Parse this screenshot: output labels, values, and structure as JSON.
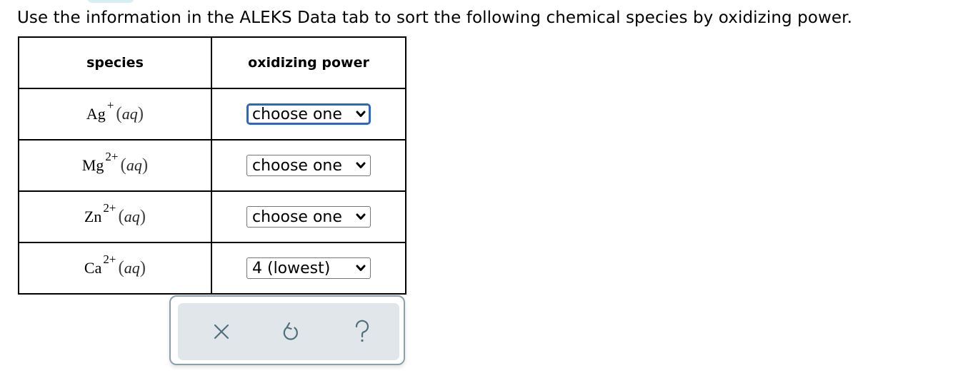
{
  "instruction": "Use the information in the ALEKS Data tab to sort the following chemical species by oxidizing power.",
  "table": {
    "headers": {
      "species": "species",
      "power": "oxidizing power"
    },
    "rows": [
      {
        "symbol": "Ag",
        "charge": "+",
        "state_open": "(",
        "state": "aq",
        "state_close": ")",
        "selected": "choose one",
        "focused": true
      },
      {
        "symbol": "Mg",
        "charge": "2+",
        "state_open": "(",
        "state": "aq",
        "state_close": ")",
        "selected": "choose one",
        "focused": false
      },
      {
        "symbol": "Zn",
        "charge": "2+",
        "state_open": "(",
        "state": "aq",
        "state_close": ")",
        "selected": "choose one",
        "focused": false
      },
      {
        "symbol": "Ca",
        "charge": "2+",
        "state_open": "(",
        "state": "aq",
        "state_close": ")",
        "selected": "4 (lowest)",
        "focused": false
      }
    ]
  },
  "toolbar": {
    "buttons": [
      {
        "name": "clear-button",
        "icon": "close-icon"
      },
      {
        "name": "undo-button",
        "icon": "undo-icon"
      },
      {
        "name": "help-button",
        "icon": "help-icon"
      }
    ]
  },
  "colors": {
    "focus": "#2a68c2",
    "toolbar_bg": "#e0e6e9",
    "toolbar_border": "#8aa0ab",
    "icon": "#4f6f7c"
  }
}
